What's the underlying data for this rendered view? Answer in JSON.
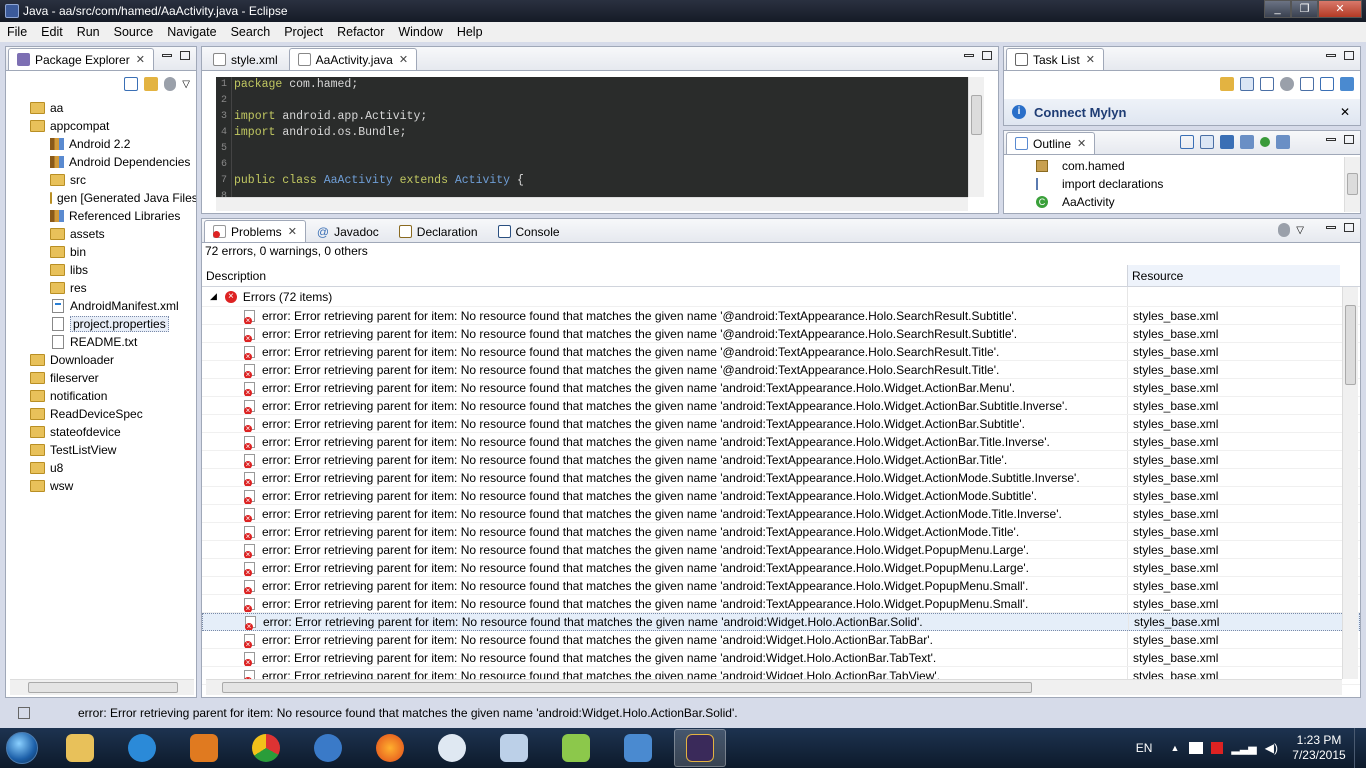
{
  "window": {
    "title": "Java - aa/src/com/hamed/AaActivity.java - Eclipse"
  },
  "menu": [
    "File",
    "Edit",
    "Run",
    "Source",
    "Navigate",
    "Search",
    "Project",
    "Refactor",
    "Window",
    "Help"
  ],
  "package_explorer": {
    "tab_label": "Package Explorer",
    "items": [
      {
        "label": "aa",
        "icon": "project-folder-icon",
        "indent": 0
      },
      {
        "label": "appcompat",
        "icon": "project-folder-icon",
        "indent": 0
      },
      {
        "label": "Android 2.2",
        "icon": "library-icon",
        "indent": 1
      },
      {
        "label": "Android Dependencies",
        "icon": "library-icon",
        "indent": 1
      },
      {
        "label": "src",
        "icon": "source-folder-icon",
        "indent": 1
      },
      {
        "label": "gen [Generated Java Files]",
        "icon": "source-folder-icon",
        "indent": 1
      },
      {
        "label": "Referenced Libraries",
        "icon": "library-icon",
        "indent": 1
      },
      {
        "label": "assets",
        "icon": "folder-icon",
        "indent": 1
      },
      {
        "label": "bin",
        "icon": "folder-icon",
        "indent": 1
      },
      {
        "label": "libs",
        "icon": "folder-icon",
        "indent": 1
      },
      {
        "label": "res",
        "icon": "folder-icon",
        "indent": 1
      },
      {
        "label": "AndroidManifest.xml",
        "icon": "xml-file-icon",
        "indent": 1
      },
      {
        "label": "project.properties",
        "icon": "text-file-icon",
        "indent": 1
      },
      {
        "label": "README.txt",
        "icon": "text-file-icon",
        "indent": 1
      },
      {
        "label": "Downloader",
        "icon": "project-folder-icon",
        "indent": 0
      },
      {
        "label": "fileserver",
        "icon": "project-folder-icon",
        "indent": 0
      },
      {
        "label": "notification",
        "icon": "project-folder-icon",
        "indent": 0
      },
      {
        "label": "ReadDeviceSpec",
        "icon": "project-folder-icon",
        "indent": 0
      },
      {
        "label": "stateofdevice",
        "icon": "project-folder-icon",
        "indent": 0
      },
      {
        "label": "TestListView",
        "icon": "project-folder-icon",
        "indent": 0
      },
      {
        "label": "u8",
        "icon": "project-folder-icon",
        "indent": 0
      },
      {
        "label": "wsw",
        "icon": "project-folder-icon",
        "indent": 0
      }
    ]
  },
  "editor": {
    "tabs": [
      {
        "label": "style.xml",
        "active": false
      },
      {
        "label": "AaActivity.java",
        "active": true
      }
    ],
    "lines": [
      {
        "n": "1",
        "text": "package com.hamed;"
      },
      {
        "n": "2",
        "text": ""
      },
      {
        "n": "3",
        "text": "import android.app.Activity;"
      },
      {
        "n": "4",
        "text": "import android.os.Bundle;"
      },
      {
        "n": "5",
        "text": ""
      },
      {
        "n": "6",
        "text": ""
      },
      {
        "n": "7",
        "text": "public class AaActivity extends Activity {"
      },
      {
        "n": "8",
        "text": ""
      }
    ]
  },
  "task_list": {
    "tab_label": "Task List",
    "connect_label": "Connect Mylyn"
  },
  "outline": {
    "tab_label": "Outline",
    "items": [
      {
        "label": "com.hamed",
        "icon": "package-icon"
      },
      {
        "label": "import declarations",
        "icon": "imports-icon"
      },
      {
        "label": "AaActivity",
        "icon": "class-icon"
      }
    ]
  },
  "bottom": {
    "tabs": [
      {
        "label": "Problems",
        "active": true
      },
      {
        "label": "Javadoc",
        "active": false
      },
      {
        "label": "Declaration",
        "active": false
      },
      {
        "label": "Console",
        "active": false
      }
    ],
    "summary": "72 errors, 0 warnings, 0 others",
    "columns": {
      "description": "Description",
      "resource": "Resource"
    },
    "group_label": "Errors (72 items)",
    "rows": [
      {
        "desc": "error: Error retrieving parent for item: No resource found that matches the given name '@android:TextAppearance.Holo.SearchResult.Subtitle'.",
        "res": "styles_base.xml"
      },
      {
        "desc": "error: Error retrieving parent for item: No resource found that matches the given name '@android:TextAppearance.Holo.SearchResult.Subtitle'.",
        "res": "styles_base.xml"
      },
      {
        "desc": "error: Error retrieving parent for item: No resource found that matches the given name '@android:TextAppearance.Holo.SearchResult.Title'.",
        "res": "styles_base.xml"
      },
      {
        "desc": "error: Error retrieving parent for item: No resource found that matches the given name '@android:TextAppearance.Holo.SearchResult.Title'.",
        "res": "styles_base.xml"
      },
      {
        "desc": "error: Error retrieving parent for item: No resource found that matches the given name 'android:TextAppearance.Holo.Widget.ActionBar.Menu'.",
        "res": "styles_base.xml"
      },
      {
        "desc": "error: Error retrieving parent for item: No resource found that matches the given name 'android:TextAppearance.Holo.Widget.ActionBar.Subtitle.Inverse'.",
        "res": "styles_base.xml"
      },
      {
        "desc": "error: Error retrieving parent for item: No resource found that matches the given name 'android:TextAppearance.Holo.Widget.ActionBar.Subtitle'.",
        "res": "styles_base.xml"
      },
      {
        "desc": "error: Error retrieving parent for item: No resource found that matches the given name 'android:TextAppearance.Holo.Widget.ActionBar.Title.Inverse'.",
        "res": "styles_base.xml"
      },
      {
        "desc": "error: Error retrieving parent for item: No resource found that matches the given name 'android:TextAppearance.Holo.Widget.ActionBar.Title'.",
        "res": "styles_base.xml"
      },
      {
        "desc": "error: Error retrieving parent for item: No resource found that matches the given name 'android:TextAppearance.Holo.Widget.ActionMode.Subtitle.Inverse'.",
        "res": "styles_base.xml"
      },
      {
        "desc": "error: Error retrieving parent for item: No resource found that matches the given name 'android:TextAppearance.Holo.Widget.ActionMode.Subtitle'.",
        "res": "styles_base.xml"
      },
      {
        "desc": "error: Error retrieving parent for item: No resource found that matches the given name 'android:TextAppearance.Holo.Widget.ActionMode.Title.Inverse'.",
        "res": "styles_base.xml"
      },
      {
        "desc": "error: Error retrieving parent for item: No resource found that matches the given name 'android:TextAppearance.Holo.Widget.ActionMode.Title'.",
        "res": "styles_base.xml"
      },
      {
        "desc": "error: Error retrieving parent for item: No resource found that matches the given name 'android:TextAppearance.Holo.Widget.PopupMenu.Large'.",
        "res": "styles_base.xml"
      },
      {
        "desc": "error: Error retrieving parent for item: No resource found that matches the given name 'android:TextAppearance.Holo.Widget.PopupMenu.Large'.",
        "res": "styles_base.xml"
      },
      {
        "desc": "error: Error retrieving parent for item: No resource found that matches the given name 'android:TextAppearance.Holo.Widget.PopupMenu.Small'.",
        "res": "styles_base.xml"
      },
      {
        "desc": "error: Error retrieving parent for item: No resource found that matches the given name 'android:TextAppearance.Holo.Widget.PopupMenu.Small'.",
        "res": "styles_base.xml"
      },
      {
        "desc": "error: Error retrieving parent for item: No resource found that matches the given name 'android:Widget.Holo.ActionBar.Solid'.",
        "res": "styles_base.xml",
        "selected": true
      },
      {
        "desc": "error: Error retrieving parent for item: No resource found that matches the given name 'android:Widget.Holo.ActionBar.TabBar'.",
        "res": "styles_base.xml"
      },
      {
        "desc": "error: Error retrieving parent for item: No resource found that matches the given name 'android:Widget.Holo.ActionBar.TabText'.",
        "res": "styles_base.xml"
      },
      {
        "desc": "error: Error retrieving parent for item: No resource found that matches the given name 'android:Widget.Holo.ActionBar.TabView'.",
        "res": "styles_base.xml"
      }
    ]
  },
  "status": {
    "message": "error: Error retrieving parent for item: No resource found that matches the given name 'android:Widget.Holo.ActionBar.Solid'."
  },
  "taskbar": {
    "apps": [
      "file-explorer-icon",
      "internet-explorer-icon",
      "media-player-icon",
      "chrome-icon",
      "thunderbird-icon",
      "firefox-icon",
      "qq-icon",
      "keyboard-icon",
      "android-icon",
      "control-panel-icon",
      "eclipse-java-ee-icon"
    ],
    "language": "EN",
    "time": "1:23 PM",
    "date": "7/23/2015"
  },
  "colors": {
    "editor_bg": "#2a2c2b",
    "keyword": "#c1c861",
    "class_name": "#6f9ed6",
    "error_red": "#dd2222",
    "selection": "#e5eef9"
  }
}
